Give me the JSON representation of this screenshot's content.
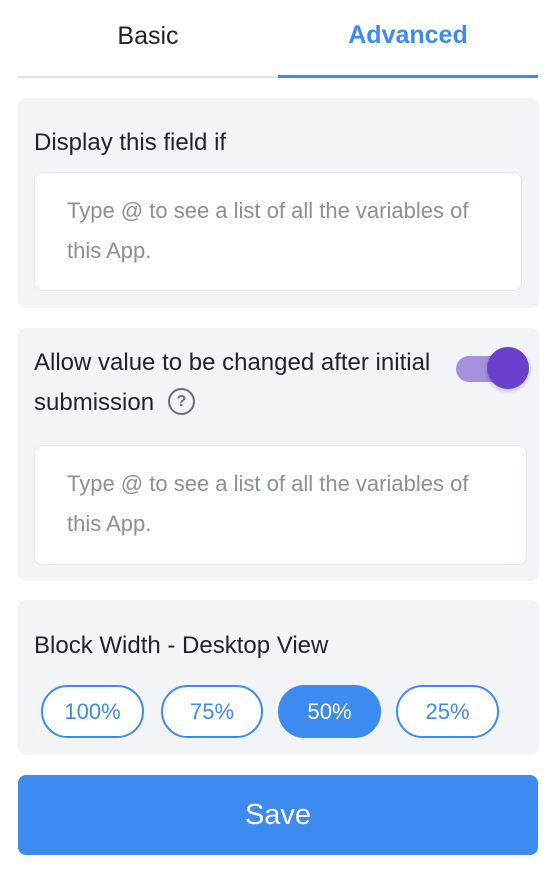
{
  "tabs": [
    {
      "label": "Basic",
      "active": false
    },
    {
      "label": "Advanced",
      "active": true
    }
  ],
  "display_condition": {
    "label": "Display this field if",
    "placeholder": "Type @ to see a list of all the variables of this App."
  },
  "allow_change": {
    "label": "Allow value to be changed after initial submission",
    "toggle_on": true,
    "help_icon": "question-circle-icon",
    "placeholder": "Type @ to see a list of all the variables of this App."
  },
  "block_width": {
    "label": "Block Width - Desktop View",
    "options": [
      "100%",
      "75%",
      "50%",
      "25%"
    ],
    "selected": "50%"
  },
  "save_label": "Save",
  "colors": {
    "accent": "#3d8bf0",
    "toggle_knob": "#6a3fcb",
    "toggle_track": "#a891dc",
    "panel_bg": "#f2f4f8"
  }
}
